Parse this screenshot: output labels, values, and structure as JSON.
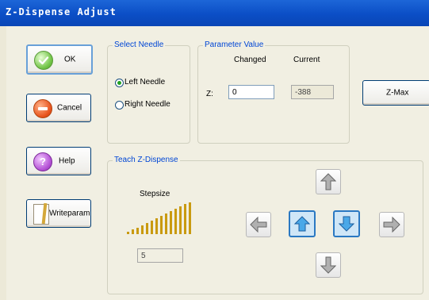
{
  "window": {
    "title": "Z-Dispense Adjust"
  },
  "buttons": {
    "ok": "OK",
    "cancel": "Cancel",
    "help": "Help",
    "help_glyph": "?",
    "writeparam": "Writeparam",
    "zmax": "Z-Max"
  },
  "select_needle": {
    "legend": "Select Needle",
    "options": [
      {
        "label": "Left Needle",
        "selected": true
      },
      {
        "label": "Right Needle",
        "selected": false
      }
    ]
  },
  "parameter_value": {
    "legend": "Parameter Value",
    "changed_header": "Changed",
    "current_header": "Current",
    "z_label": "Z:",
    "changed_value": "0",
    "current_value": "-388"
  },
  "teach": {
    "legend": "Teach Z-Dispense",
    "stepsize_label": "Stepsize",
    "stepsize_value": "5",
    "arrows": [
      {
        "name": "up-arrow-icon",
        "type": "grey-up"
      },
      {
        "name": "left-arrow-icon",
        "type": "grey-left"
      },
      {
        "name": "z-up-arrow-icon",
        "type": "blue-up"
      },
      {
        "name": "z-down-arrow-icon",
        "type": "blue-down"
      },
      {
        "name": "right-arrow-icon",
        "type": "grey-right"
      },
      {
        "name": "down-arrow-icon",
        "type": "grey-down"
      }
    ]
  },
  "colors": {
    "titlebar": "#0b4ec6",
    "legend_text": "#0046d5",
    "stepsize_bars": "#c99a10",
    "arrow_blue": "#1d8fd8"
  }
}
